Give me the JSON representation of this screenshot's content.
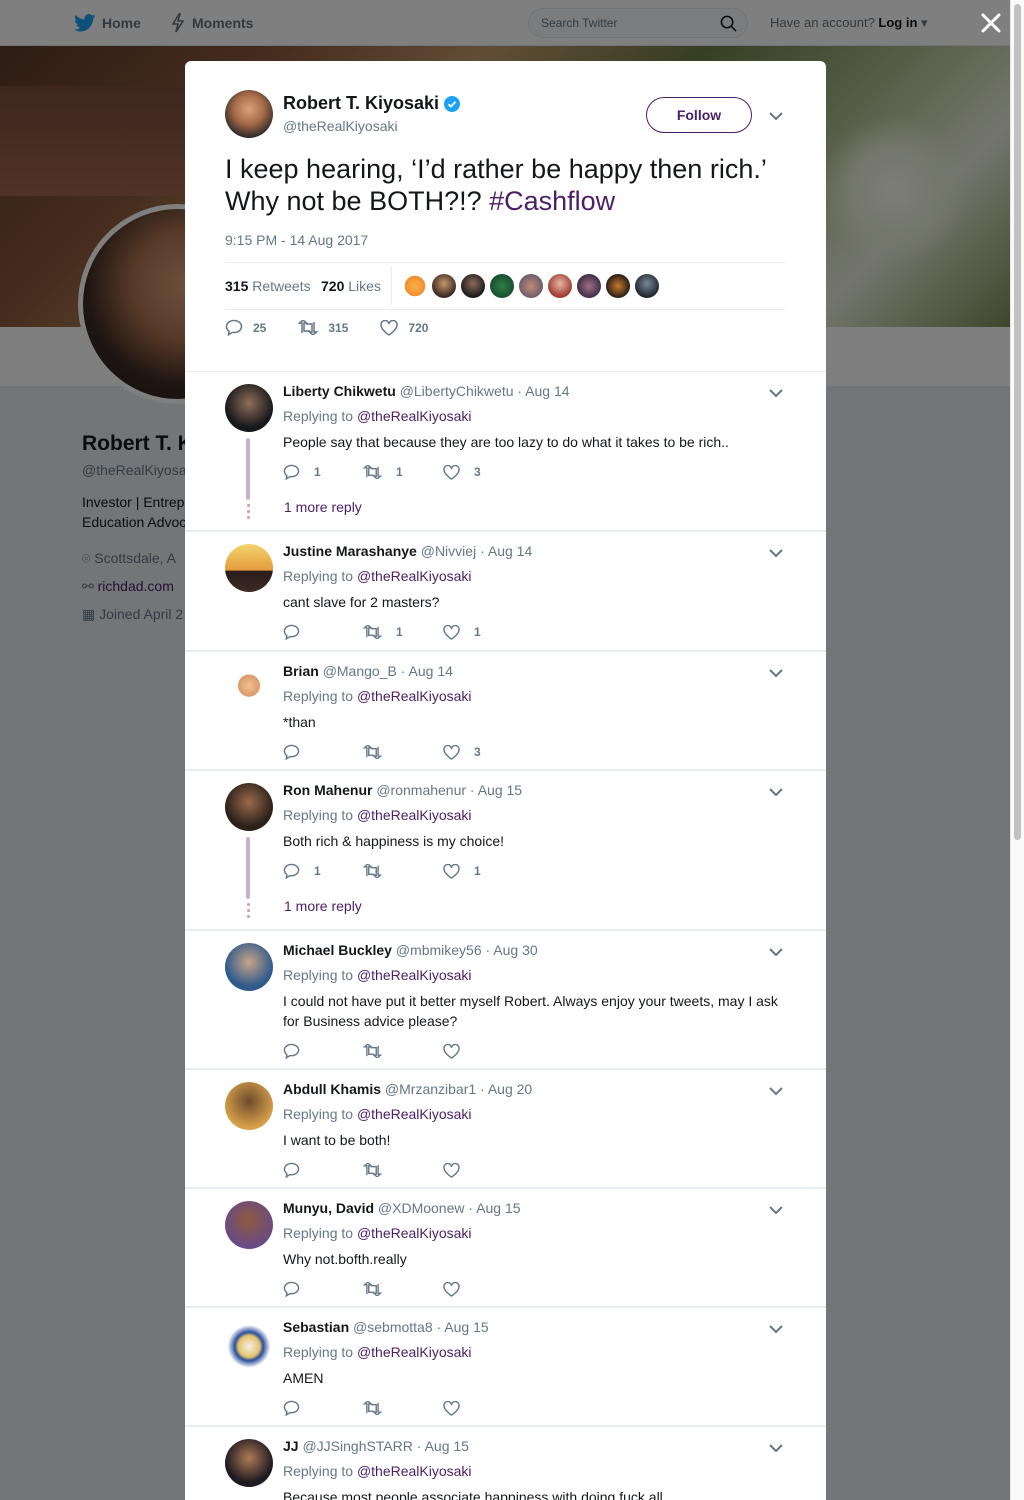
{
  "nav": {
    "home_label": "Home",
    "moments_label": "Moments",
    "search_placeholder": "Search Twitter",
    "account_prompt": "Have an account?",
    "login_label": "Log in"
  },
  "background_profile": {
    "name": "Robert T. K",
    "handle": "@theRealKiyosal",
    "bio_line1": "Investor | Entrepr",
    "bio_line2": "Education Advoc",
    "location": "Scottsdale, A",
    "website": "richdad.com",
    "joined": "Joined April 2"
  },
  "tweet": {
    "author_name": "Robert T. Kiyosaki",
    "author_handle": "@theRealKiyosaki",
    "follow_label": "Follow",
    "text": "I keep hearing, ‘I’d rather be happy then rich.’ Why not be BOTH?!? ",
    "hashtag": "#Cashflow",
    "timestamp": "9:15 PM - 14 Aug 2017",
    "retweets_count": "315",
    "retweets_label": "Retweets",
    "likes_count": "720",
    "likes_label": "Likes",
    "reply_count": "25",
    "retweet_action_count": "315",
    "like_action_count": "720"
  },
  "colors": {
    "accent": "#4a1f66",
    "verified": "#1da1f2",
    "muted": "#657786",
    "thread": "#c7b3d1"
  },
  "replies": [
    {
      "name": "Liberty Chikwetu",
      "handle": "@LibertyChikwetu",
      "date": "Aug 14",
      "replying_prefix": "Replying to",
      "mention": "@theRealKiyosaki",
      "text": "People say that because they are too lazy to do what it takes to be rich..",
      "replies": "1",
      "retweets": "1",
      "likes": "3",
      "more": "1 more reply"
    },
    {
      "name": "Justine Marashanye",
      "handle": "@Nivviej",
      "date": "Aug 14",
      "replying_prefix": "Replying to",
      "mention": "@theRealKiyosaki",
      "text": "cant slave for 2 masters?",
      "replies": "",
      "retweets": "1",
      "likes": "1",
      "more": ""
    },
    {
      "name": "Brian",
      "handle": "@Mango_B",
      "date": "Aug 14",
      "replying_prefix": "Replying to",
      "mention": "@theRealKiyosaki",
      "text": "*than",
      "replies": "",
      "retweets": "",
      "likes": "3",
      "more": ""
    },
    {
      "name": "Ron Mahenur",
      "handle": "@ronmahenur",
      "date": "Aug 15",
      "replying_prefix": "Replying to",
      "mention": "@theRealKiyosaki",
      "text": "Both rich & happiness is my choice!",
      "replies": "1",
      "retweets": "",
      "likes": "1",
      "more": "1 more reply"
    },
    {
      "name": "Michael Buckley",
      "handle": "@mbmikey56",
      "date": "Aug 30",
      "replying_prefix": "Replying to",
      "mention": "@theRealKiyosaki",
      "text": "I could not have put it better myself Robert. Always enjoy your tweets, may I ask for Business advice please?",
      "replies": "",
      "retweets": "",
      "likes": "",
      "more": ""
    },
    {
      "name": "Abdull Khamis",
      "handle": "@Mrzanzibar1",
      "date": "Aug 20",
      "replying_prefix": "Replying to",
      "mention": "@theRealKiyosaki",
      "text": "I want to be both!",
      "replies": "",
      "retweets": "",
      "likes": "",
      "more": ""
    },
    {
      "name": "Munyu, David",
      "handle": "@XDMoonew",
      "date": "Aug 15",
      "replying_prefix": "Replying to",
      "mention": "@theRealKiyosaki",
      "text": "Why not.bofth.really",
      "replies": "",
      "retweets": "",
      "likes": "",
      "more": ""
    },
    {
      "name": "Sebastian",
      "handle": "@sebmotta8",
      "date": "Aug 15",
      "replying_prefix": "Replying to",
      "mention": "@theRealKiyosaki",
      "text": "AMEN",
      "replies": "",
      "retweets": "",
      "likes": "",
      "more": ""
    },
    {
      "name": "JJ",
      "handle": "@JJSinghSTARR",
      "date": "Aug 15",
      "replying_prefix": "Replying to",
      "mention": "@theRealKiyosaki",
      "text": "Because most people associate happiness with doing fuck all",
      "replies": "",
      "retweets": "",
      "likes": "",
      "more": ""
    }
  ]
}
